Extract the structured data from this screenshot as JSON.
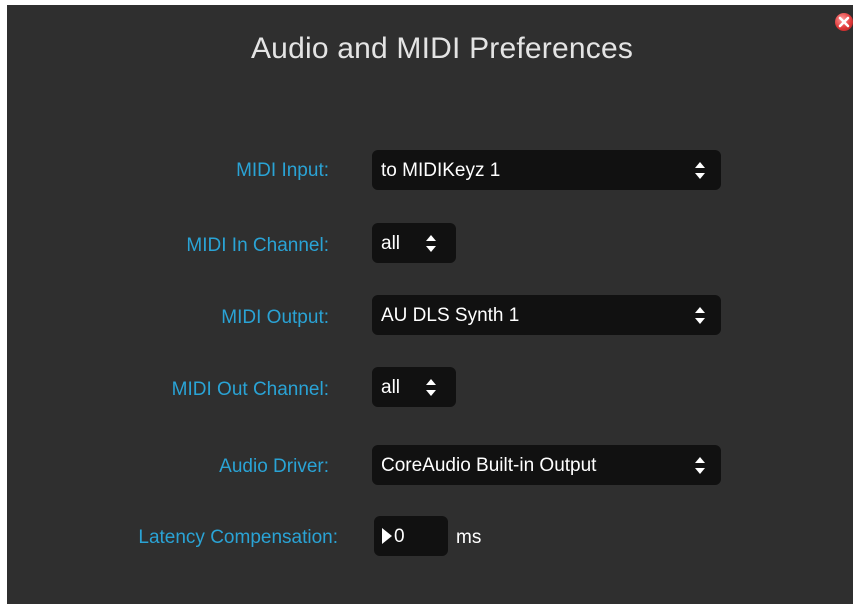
{
  "dialog": {
    "title": "Audio and MIDI Preferences"
  },
  "close_button": {
    "icon": "close-icon",
    "color": "#e03a3a"
  },
  "fields": {
    "midi_input": {
      "label": "MIDI Input:",
      "value": "to MIDIKeyz 1"
    },
    "midi_in_channel": {
      "label": "MIDI In Channel:",
      "value": "all"
    },
    "midi_output": {
      "label": "MIDI Output:",
      "value": "AU DLS Synth 1"
    },
    "midi_out_channel": {
      "label": "MIDI Out Channel:",
      "value": "all"
    },
    "audio_driver": {
      "label": "Audio Driver:",
      "value": "CoreAudio Built-in Output"
    },
    "latency": {
      "label": "Latency Compensation:",
      "value": "0",
      "unit": "ms"
    }
  },
  "colors": {
    "background": "#2f2f2f",
    "label_accent": "#2aa3d5",
    "control_bg": "#111111",
    "text": "#ffffff"
  }
}
